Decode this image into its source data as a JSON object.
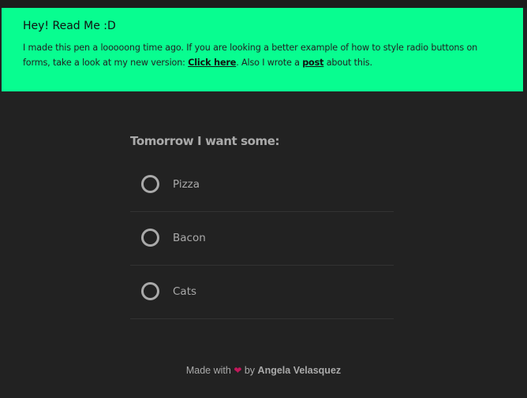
{
  "notice": {
    "title": "Hey! Read Me :D",
    "text_before_link": "I made this pen a looooong time ago. If you are looking a better example of how to style radio buttons on forms, take a look at my new version: ",
    "link1_label": "Click here",
    "text_between": ". Also I wrote a ",
    "link2_label": "post",
    "text_after": " about this.",
    "background_color": "#08fd90"
  },
  "form": {
    "heading": "Tomorrow I want some:",
    "options": [
      {
        "label": "Pizza",
        "checked": false
      },
      {
        "label": "Bacon",
        "checked": false
      },
      {
        "label": "Cats",
        "checked": false
      }
    ]
  },
  "footer": {
    "made_with": "Made with",
    "heart_icon": "heart-icon",
    "by": "by",
    "author": "Angela Velasquez",
    "heart_color": "#c2185b"
  },
  "colors": {
    "background": "#222222",
    "text_muted": "#aaaaaa",
    "divider": "#333333"
  }
}
